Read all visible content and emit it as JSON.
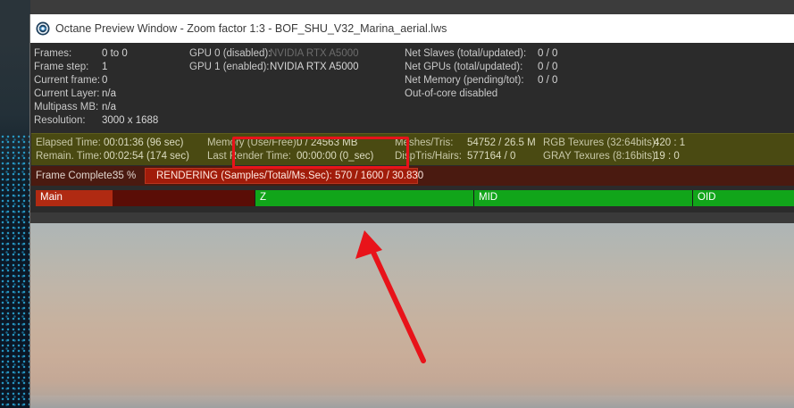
{
  "window": {
    "title": "Octane Preview Window - Zoom factor 1:3 - BOF_SHU_V32_Marina_aerial.lws",
    "icon": "octane-logo-icon"
  },
  "stats_left": [
    {
      "label": "Frames:",
      "value": "0 to 0"
    },
    {
      "label": "Frame step:",
      "value": "1"
    },
    {
      "label": "Current frame:",
      "value": "0"
    },
    {
      "label": "Current Layer:",
      "value": "n/a"
    },
    {
      "label": "Multipass MB:",
      "value": "n/a"
    },
    {
      "label": "Resolution:",
      "value": "3000 x 1688"
    }
  ],
  "gpus": [
    {
      "label": "GPU  0 (disabled):",
      "value": "NVIDIA RTX A5000",
      "enabled": false
    },
    {
      "label": "GPU  1 (enabled):",
      "value": "NVIDIA RTX A5000",
      "enabled": true
    }
  ],
  "net": [
    {
      "label": "Net Slaves (total/updated):",
      "value": "0 / 0"
    },
    {
      "label": "Net GPUs (total/updated):",
      "value": "0 / 0"
    },
    {
      "label": "Net Memory (pending/tot):",
      "value": "0 / 0"
    }
  ],
  "out_of_core": "Out-of-core disabled",
  "band": {
    "elapsed_label": "Elapsed Time:",
    "elapsed_value": "00:01:36 (96 sec)",
    "remain_label": "Remain. Time:",
    "remain_value": "00:02:54 (174 sec)",
    "memory_label": "Memory (Use/Free):",
    "memory_value": "0 / 24563 MB",
    "last_render_label": "Last Render Time:",
    "last_render_value": "00:00:00 (0_sec)",
    "meshes_label": "Meshes/Tris:",
    "meshes_value": "54752 / 26.5 M",
    "disp_label": "DispTris/Hairs:",
    "disp_value": "577164 / 0",
    "rgb_label": "RGB Texures (32:64bits):",
    "rgb_value": "420 : 1",
    "gray_label": "GRAY Texures (8:16bits):",
    "gray_value": "19 : 0"
  },
  "render": {
    "frame_complete_label": "Frame Complete:",
    "frame_complete_value": "35 %",
    "progress": 0.35,
    "status": "RENDERING (Samples/Total/Ms.Sec): 570 / 1600 / 30.830"
  },
  "passes": [
    {
      "label": "Main",
      "state": "in-progress",
      "progress": 0.35
    },
    {
      "label": "Z",
      "state": "complete"
    },
    {
      "label": "MID",
      "state": "complete"
    },
    {
      "label": "OID",
      "state": "complete"
    }
  ],
  "colors": {
    "highlight": "#e8131a",
    "pass_complete": "#11a51a",
    "pass_progress": "#b02a12",
    "band_yellow": "#4a4a12"
  }
}
